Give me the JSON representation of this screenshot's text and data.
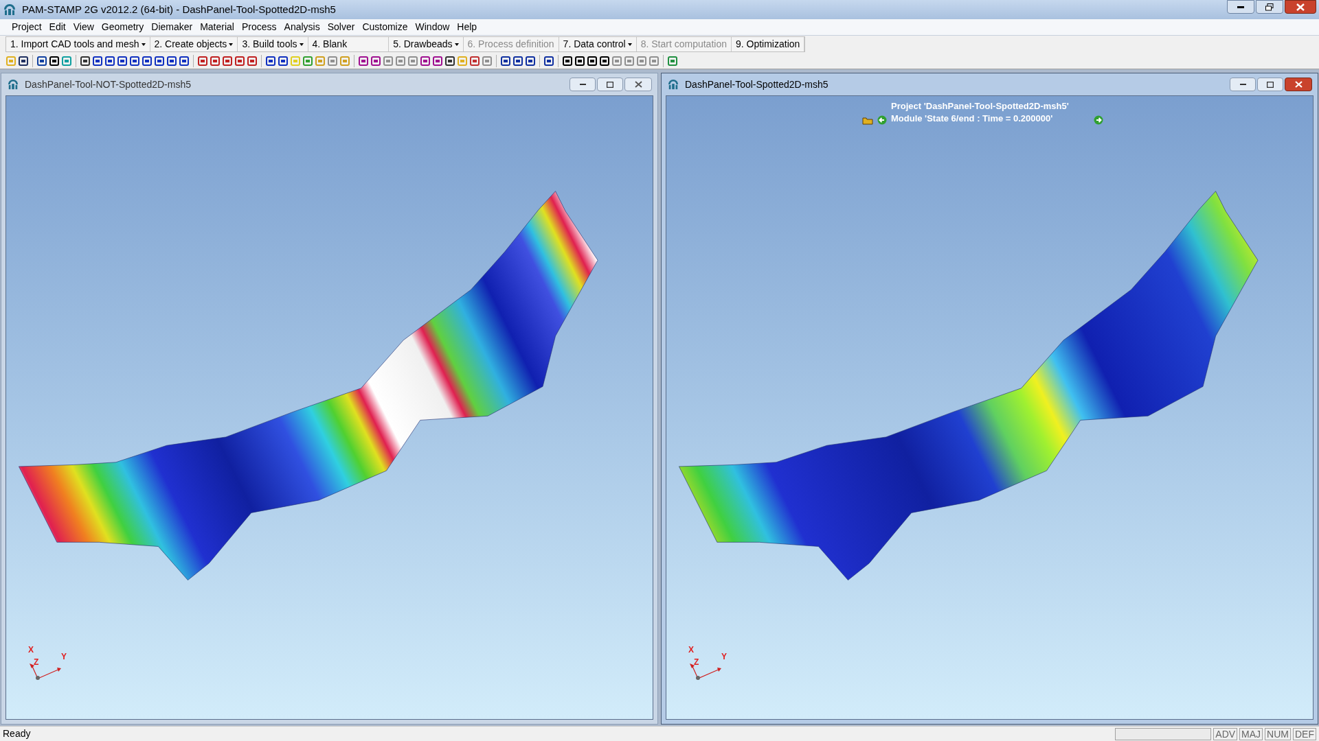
{
  "window": {
    "title": "PAM-STAMP 2G v2012.2 (64-bit) - DashPanel-Tool-Spotted2D-msh5"
  },
  "menu": [
    "Project",
    "Edit",
    "View",
    "Geometry",
    "Diemaker",
    "Material",
    "Process",
    "Analysis",
    "Solver",
    "Customize",
    "Window",
    "Help"
  ],
  "workflow": [
    {
      "label": "1. Import CAD tools and mesh",
      "dropdown": true,
      "disabled": false
    },
    {
      "label": "2. Create objects",
      "dropdown": true,
      "disabled": false
    },
    {
      "label": "3. Build tools",
      "dropdown": true,
      "disabled": false
    },
    {
      "label": "4. Blank",
      "dropdown": false,
      "disabled": false
    },
    {
      "label": "5. Drawbeads",
      "dropdown": true,
      "disabled": false
    },
    {
      "label": "6. Process definition",
      "dropdown": false,
      "disabled": true
    },
    {
      "label": "7. Data control",
      "dropdown": true,
      "disabled": false
    },
    {
      "label": "8. Start computation",
      "dropdown": false,
      "disabled": true
    },
    {
      "label": "9. Optimization",
      "dropdown": false,
      "disabled": false
    }
  ],
  "viewports": [
    {
      "title": "DashPanel-Tool-NOT-Spotted2D-msh5",
      "kind": "unspotted",
      "active": false,
      "axes": [
        "X",
        "Z",
        "Y"
      ]
    },
    {
      "title": "DashPanel-Tool-Spotted2D-msh5",
      "kind": "spotted",
      "active": true,
      "axes": [
        "X",
        "Z",
        "Y"
      ],
      "info": [
        "Project 'DashPanel-Tool-Spotted2D-msh5'",
        "Module 'State 6/end : Time = 0.200000'"
      ]
    }
  ],
  "status_bar": {
    "text": "Ready",
    "indicators": [
      "ADV",
      "MAJ",
      "NUM",
      "DEF"
    ]
  }
}
